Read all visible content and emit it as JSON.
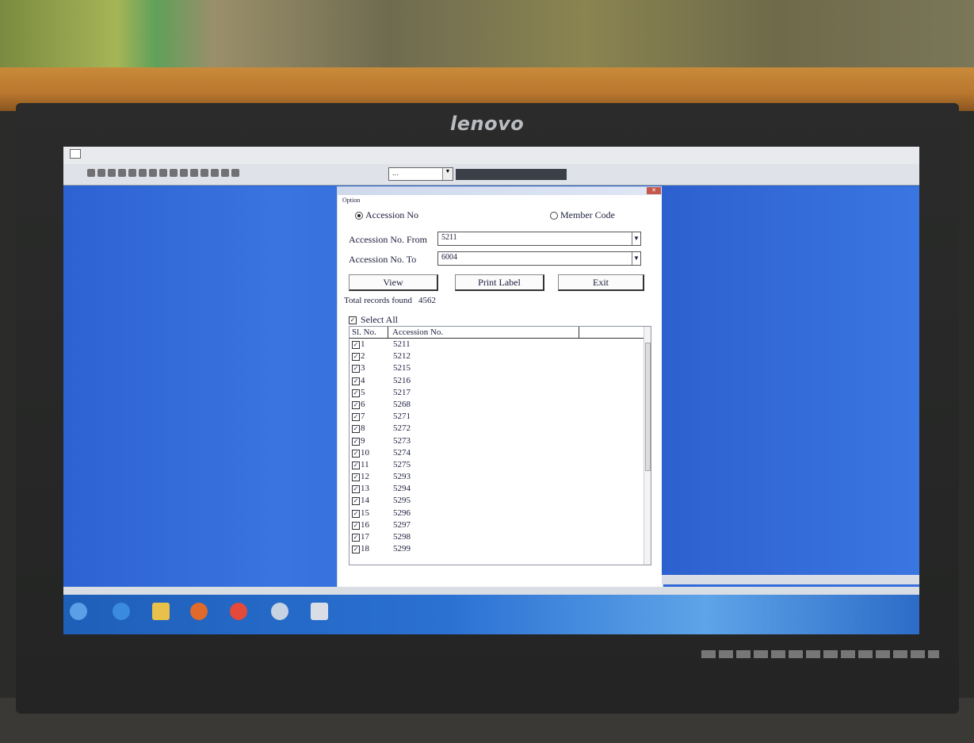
{
  "monitor": {
    "brand": "lenovo"
  },
  "app": {
    "toolbar_combo_value": "..."
  },
  "dialog": {
    "option_group_label": "Option",
    "radio_accession": "Accession No",
    "radio_member": "Member Code",
    "accession_from_label": "Accession No. From",
    "accession_from_value": "5211",
    "accession_to_label": "Accession No. To",
    "accession_to_value": "6004",
    "view_label": "View",
    "print_label": "Print Label",
    "exit_label": "Exit",
    "total_label": "Total records found",
    "total_count": "4562",
    "select_all_label": "Select All",
    "columns": [
      "Sl. No.",
      "Accession No."
    ],
    "rows": [
      {
        "sl": "1",
        "acc": "5211"
      },
      {
        "sl": "2",
        "acc": "5212"
      },
      {
        "sl": "3",
        "acc": "5215"
      },
      {
        "sl": "4",
        "acc": "5216"
      },
      {
        "sl": "5",
        "acc": "5217"
      },
      {
        "sl": "6",
        "acc": "5268"
      },
      {
        "sl": "7",
        "acc": "5271"
      },
      {
        "sl": "8",
        "acc": "5272"
      },
      {
        "sl": "9",
        "acc": "5273"
      },
      {
        "sl": "10",
        "acc": "5274"
      },
      {
        "sl": "11",
        "acc": "5275"
      },
      {
        "sl": "12",
        "acc": "5293"
      },
      {
        "sl": "13",
        "acc": "5294"
      },
      {
        "sl": "14",
        "acc": "5295"
      },
      {
        "sl": "15",
        "acc": "5296"
      },
      {
        "sl": "16",
        "acc": "5297"
      },
      {
        "sl": "17",
        "acc": "5298"
      },
      {
        "sl": "18",
        "acc": "5299"
      }
    ]
  },
  "colors": {
    "desktop_blue": "#2f66d6",
    "taskbar_blue": "#2b71d3"
  }
}
